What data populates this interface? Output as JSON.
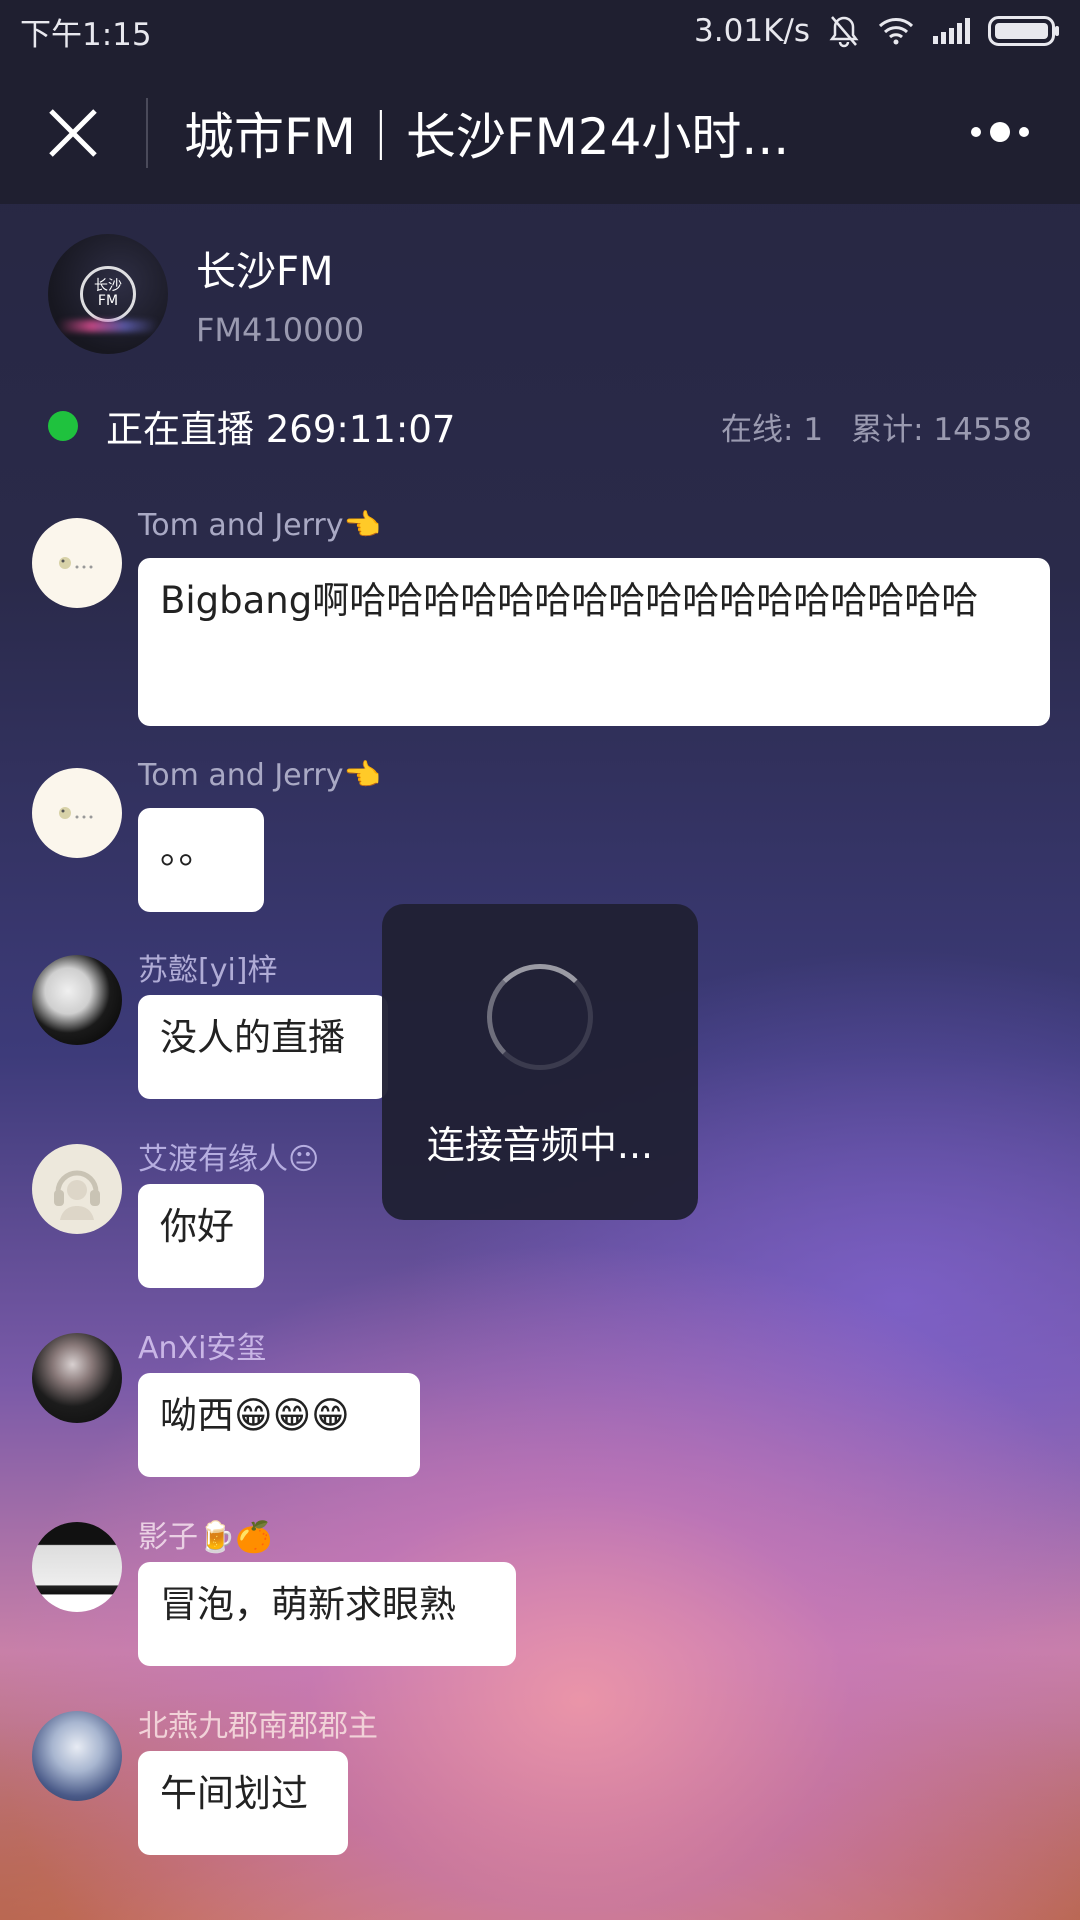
{
  "status_bar": {
    "time": "下午1:15",
    "net_speed": "3.01K/s"
  },
  "nav": {
    "title": "城市FM｜长沙FM24小时..."
  },
  "station": {
    "name": "长沙FM",
    "id": "FM410000",
    "logo_text_1": "长沙",
    "logo_text_2": "FM"
  },
  "live": {
    "status": "正在直播 269:11:07",
    "online": "在线: 1",
    "total": "累计: 14558",
    "dot_color": "#1fc23e"
  },
  "messages": [
    {
      "sender": "Tom and Jerry👈",
      "text": "Bigbang啊哈哈哈哈哈哈哈哈哈哈哈哈哈哈哈哈哈",
      "sender_color": "#a9a9c4"
    },
    {
      "sender": "Tom and Jerry👈",
      "text": "。。",
      "sender_color": "#a9a9c4"
    },
    {
      "sender": "苏懿[yi]梓",
      "text": "没人的直播",
      "sender_color": "#b0acd6"
    },
    {
      "sender": "艾渡有缘人😐",
      "text": "你好",
      "sender_color": "#b6aee0"
    },
    {
      "sender": "AnXi安玺",
      "text": "呦西😁😁😁",
      "sender_color": "#c9b6e6"
    },
    {
      "sender": "影子🍺🍊",
      "text": "冒泡，萌新求眼熟",
      "sender_color": "#ead0e4"
    },
    {
      "sender": "北燕九郡南郡郡主",
      "text": "午间划过",
      "sender_color": "#f1d2d8"
    }
  ],
  "toast": {
    "text": "连接音频中..."
  },
  "icons": {
    "close": "close-icon",
    "more": "more-icon",
    "bell_off": "bell-off-icon",
    "wifi": "wifi-icon",
    "signal": "signal-icon",
    "battery": "battery-icon"
  }
}
